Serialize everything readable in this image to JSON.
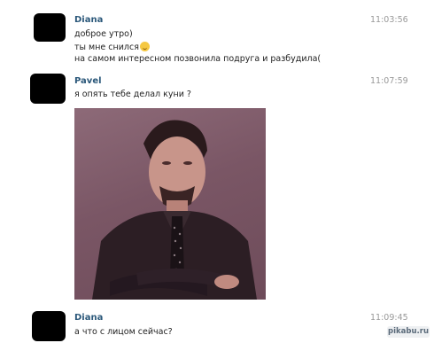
{
  "messages": [
    {
      "sender": "Diana",
      "time": "11:03:56",
      "lines": [
        "доброе утро)",
        "ты мне снился",
        "на самом интересном позвонила подруга и разбудила("
      ]
    },
    {
      "sender": "Pavel",
      "time": "11:07:59",
      "lines": [
        "я опять тебе делал куни ?"
      ]
    },
    {
      "sender": "Diana",
      "time": "11:09:45",
      "lines": [
        "а что с лицом сейчас?"
      ]
    }
  ],
  "icons": {
    "emoji": "smiling-face-icon"
  },
  "watermark": "pikabu.ru"
}
